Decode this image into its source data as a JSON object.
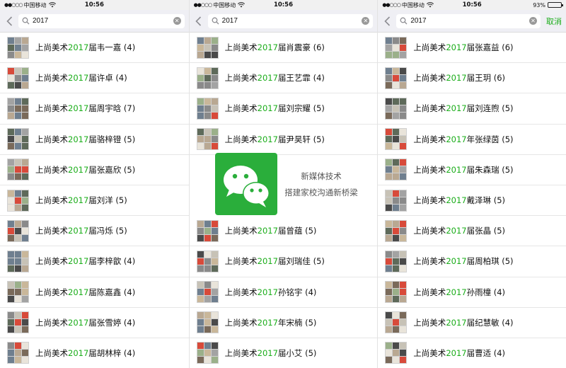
{
  "status": {
    "carrier": "中国移动",
    "time": "10:56",
    "battery": "93%",
    "battery_level": 0.93
  },
  "search": {
    "query": "2017",
    "cancel_label": "取消"
  },
  "colors": {
    "accent_green": "#1aad19",
    "logo_green": "#2aae3b",
    "search_bg": "#efeff4"
  },
  "watermark": {
    "line1": "新媒体技术",
    "line2": "搭建家校沟通新桥梁"
  },
  "panels": [
    {
      "rows": [
        {
          "pre": "上尚美术",
          "hl": "2017",
          "post": "届韦一嘉 (4)"
        },
        {
          "pre": "上尚美术",
          "hl": "2017",
          "post": "届许卓 (4)"
        },
        {
          "pre": "上尚美术",
          "hl": "2017",
          "post": "届周宇晗 (7)"
        },
        {
          "pre": "上尚美术",
          "hl": "2017",
          "post": "届骆梓镫 (5)"
        },
        {
          "pre": "上尚美术",
          "hl": "2017",
          "post": "届张嘉欣 (5)"
        },
        {
          "pre": "上尚美术",
          "hl": "2017",
          "post": "届刘洋 (5)"
        },
        {
          "pre": "上尚美术",
          "hl": "2017",
          "post": "届冯烁 (5)"
        },
        {
          "pre": "上尚美术",
          "hl": "2017",
          "post": "届李梓歆 (4)"
        },
        {
          "pre": "上尚美术",
          "hl": "2017",
          "post": "届陈嘉鑫 (4)"
        },
        {
          "pre": "上尚美术",
          "hl": "2017",
          "post": "届张雪婷 (4)"
        },
        {
          "pre": "上尚美术",
          "hl": "2017",
          "post": "届胡林梓 (4)"
        }
      ]
    },
    {
      "rows": [
        {
          "pre": "上尚美术",
          "hl": "2017",
          "post": "届肖震豪 (6)"
        },
        {
          "pre": "上尚美术",
          "hl": "2017",
          "post": "届王艺霏 (4)"
        },
        {
          "pre": "上尚美术",
          "hl": "2017",
          "post": "届刘宗耀 (5)"
        },
        {
          "pre": "上尚美术",
          "hl": "2017",
          "post": "届尹昊轩 (5)"
        },
        {
          "pre": "",
          "hl": "",
          "post": ""
        },
        {
          "pre": "",
          "hl": "",
          "post": ""
        },
        {
          "pre": "上尚美术",
          "hl": "2017",
          "post": "届曾蕴 (5)"
        },
        {
          "pre": "上尚美术",
          "hl": "2017",
          "post": "届刘瑞佳 (5)"
        },
        {
          "pre": "上尚美术",
          "hl": "2017",
          "post": "孙铭宇 (4)"
        },
        {
          "pre": "上尚美术",
          "hl": "2017",
          "post": "年宋楠 (5)"
        },
        {
          "pre": "上尚美术",
          "hl": "2017",
          "post": "届小艾 (5)"
        }
      ]
    },
    {
      "rows": [
        {
          "pre": "上尚美术",
          "hl": "2017",
          "post": "届张嘉益 (6)"
        },
        {
          "pre": "上尚美术",
          "hl": "2017",
          "post": "届王玥 (6)"
        },
        {
          "pre": "上尚美术",
          "hl": "2017",
          "post": "届刘连煦 (5)"
        },
        {
          "pre": "上尚美术",
          "hl": "2017",
          "post": "年张绿茵 (5)"
        },
        {
          "pre": "上尚美术",
          "hl": "2017",
          "post": "届朱森瑞 (5)"
        },
        {
          "pre": "上尚美术",
          "hl": "2017",
          "post": "戴泽琳 (5)"
        },
        {
          "pre": "上尚美术",
          "hl": "2017",
          "post": "届张晶 (5)"
        },
        {
          "pre": "上尚美术",
          "hl": "2017",
          "post": "届周柏琪 (5)"
        },
        {
          "pre": "上尚美术",
          "hl": "2017",
          "post": "孙雨橦 (4)"
        },
        {
          "pre": "上尚美术",
          "hl": "2017",
          "post": "届纪慧敏 (4)"
        },
        {
          "pre": "上尚美术",
          "hl": "2017",
          "post": "届曹适 (4)"
        }
      ]
    }
  ]
}
